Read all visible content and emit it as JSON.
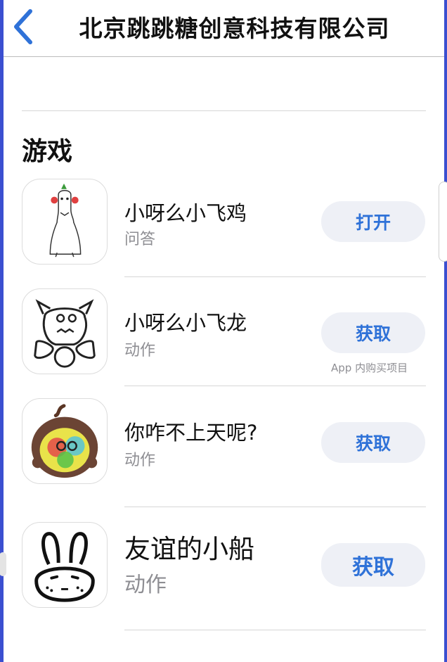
{
  "header": {
    "title": "北京跳跳糖创意科技有限公司"
  },
  "section": {
    "title": "游戏"
  },
  "apps": [
    {
      "name": "小呀么小飞鸡",
      "category": "问答",
      "button": "打开",
      "icon": "chicken-bottle-icon"
    },
    {
      "name": "小呀么小飞龙",
      "category": "动作",
      "button": "获取",
      "note": "App 内购买项目",
      "icon": "dragon-doodle-icon"
    },
    {
      "name": "你咋不上天呢?",
      "category": "动作",
      "button": "获取",
      "icon": "rainbow-face-icon"
    },
    {
      "name": "友谊的小船",
      "category": "动作",
      "button": "获取",
      "icon": "rabbit-face-icon"
    }
  ],
  "colors": {
    "accent": "#2f72d8",
    "button_bg": "#eef0f6",
    "secondary_text": "#8e8e93",
    "frame": "#3b4fd0"
  }
}
